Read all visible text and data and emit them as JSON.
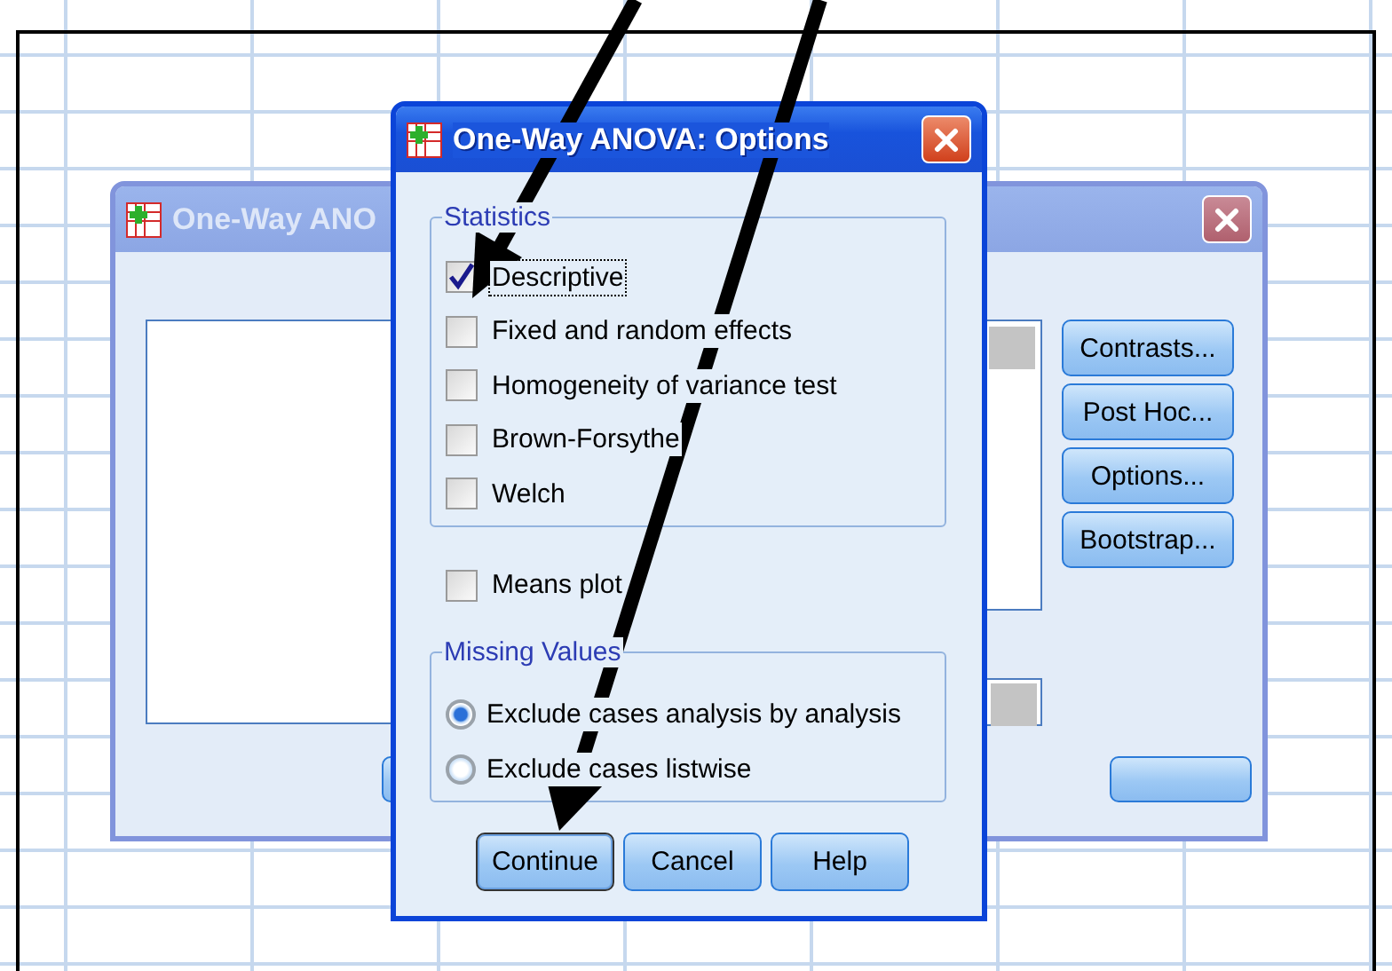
{
  "background_dialog": {
    "title": "One-Way ANO",
    "active": false,
    "buttons": [
      {
        "label": "Contrasts..."
      },
      {
        "label": "Post Hoc..."
      },
      {
        "label": "Options..."
      },
      {
        "label": "Bootstrap..."
      }
    ]
  },
  "dialog": {
    "title": "One-Way ANOVA: Options",
    "active": true,
    "statistics": {
      "legend": "Statistics",
      "options": [
        {
          "label": "Descriptive",
          "checked": true,
          "focused": true
        },
        {
          "label": "Fixed and random effects",
          "checked": false,
          "focused": false
        },
        {
          "label": "Homogeneity of variance test",
          "checked": false,
          "focused": false
        },
        {
          "label": "Brown-Forsythe",
          "checked": false,
          "focused": false
        },
        {
          "label": "Welch",
          "checked": false,
          "focused": false
        }
      ]
    },
    "means_plot": {
      "label": "Means plot",
      "checked": false
    },
    "missing_values": {
      "legend": "Missing Values",
      "options": [
        {
          "label": "Exclude cases analysis by analysis",
          "selected": true
        },
        {
          "label": "Exclude cases listwise",
          "selected": false
        }
      ]
    },
    "buttons": [
      {
        "label": "Continue",
        "default": true
      },
      {
        "label": "Cancel",
        "default": false
      },
      {
        "label": "Help",
        "default": false
      }
    ]
  }
}
